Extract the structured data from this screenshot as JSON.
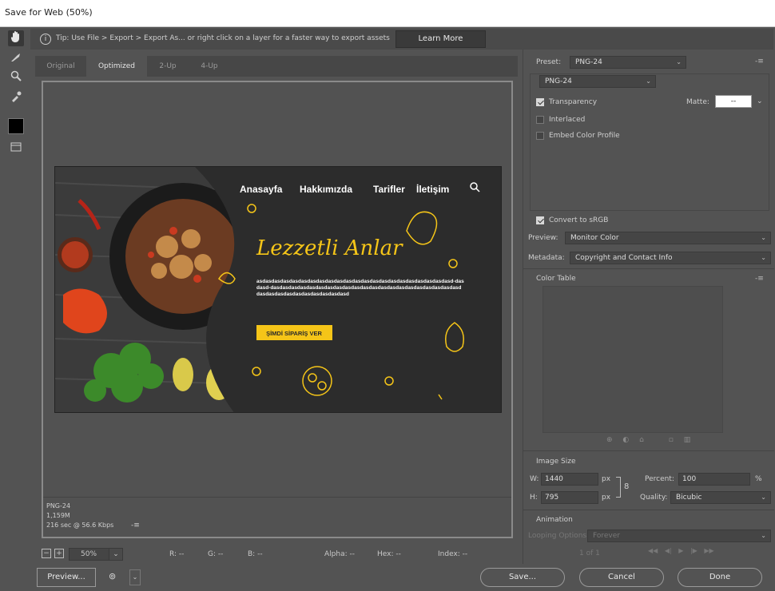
{
  "window": {
    "title": "Save for Web (50%)"
  },
  "tip": {
    "text": "Tip: Use File > Export > Export As...  or right click on a layer for a faster way to export assets",
    "learn_more": "Learn More"
  },
  "tools": [
    "hand-icon",
    "slice-select-icon",
    "zoom-icon",
    "eyedropper-icon",
    "color-swatch",
    "toggle-slices-icon"
  ],
  "tabs": [
    {
      "label": "Original",
      "active": false
    },
    {
      "label": "Optimized",
      "active": true
    },
    {
      "label": "2-Up",
      "active": false
    },
    {
      "label": "4-Up",
      "active": false
    }
  ],
  "preview": {
    "nav": [
      "Anasayfa",
      "Hakkımızda",
      "Tarifler",
      "İletişim"
    ],
    "headline": "Lezzetli Anlar",
    "body": "asdasdasdasdasdasdasdasdasdasdasdasdasdasdasdasdasdasdasdasdasdasd-dasdasd-dasdasdasdasdasdasdasdasdasdasdasdasdasdasdasdasdasdasdasdasdasd dasdasdasdasdasdasdasdasdasdasd",
    "cta": "ŞİMDİ SİPARİŞ VER",
    "accent": "#f5c518"
  },
  "info": {
    "format": "PNG-24",
    "size": "1,159M",
    "time": "216 sec @ 56.6 Kbps"
  },
  "statusbar": {
    "zoom": "50%",
    "r": "R: --",
    "g": "G: --",
    "b": "B: --",
    "alpha": "Alpha: --",
    "hex": "Hex: --",
    "index": "Index: --"
  },
  "buttons": {
    "preview": "Preview...",
    "save": "Save...",
    "cancel": "Cancel",
    "done": "Done"
  },
  "settings": {
    "preset_label": "Preset:",
    "preset_value": "PNG-24",
    "format_value": "PNG-24",
    "transparency": "Transparency",
    "transparency_checked": true,
    "matte_label": "Matte:",
    "matte_value": "--",
    "interlaced": "Interlaced",
    "interlaced_checked": false,
    "embed_profile": "Embed Color Profile",
    "embed_checked": false,
    "convert_srgb": "Convert to sRGB",
    "convert_checked": true,
    "preview_label": "Preview:",
    "preview_value": "Monitor Color",
    "metadata_label": "Metadata:",
    "metadata_value": "Copyright and Contact Info"
  },
  "color_table": {
    "title": "Color Table"
  },
  "image_size": {
    "title": "Image Size",
    "w_label": "W:",
    "w_value": "1440",
    "h_label": "H:",
    "h_value": "795",
    "unit": "px",
    "percent_label": "Percent:",
    "percent_value": "100",
    "percent_unit": "%",
    "quality_label": "Quality:",
    "quality_value": "Bicubic"
  },
  "animation": {
    "title": "Animation",
    "looping_label": "Looping Options:",
    "looping_value": "Forever",
    "frame": "1 of 1"
  }
}
